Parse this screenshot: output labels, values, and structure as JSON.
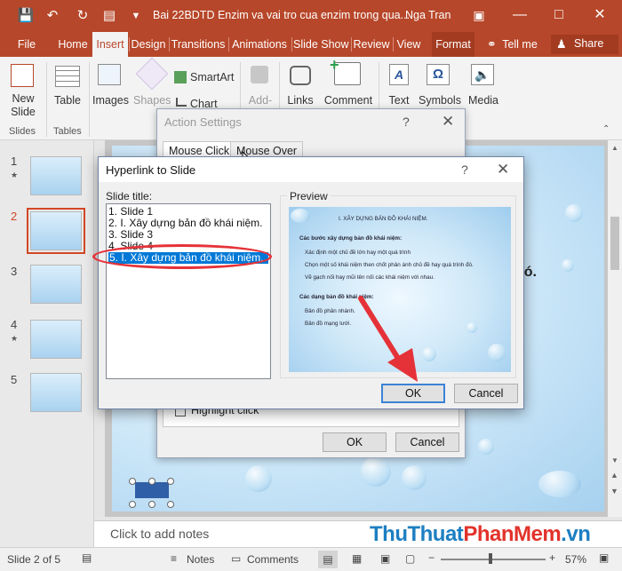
{
  "title_bar": {
    "document_title": "Bai 22BDTD Enzim va vai tro cua enzim trong qua...",
    "user_name": "Nga Tran"
  },
  "tabs": [
    {
      "label": "File"
    },
    {
      "label": "Home"
    },
    {
      "label": "Insert"
    },
    {
      "label": "Design"
    },
    {
      "label": "Transitions"
    },
    {
      "label": "Animations"
    },
    {
      "label": "Slide Show"
    },
    {
      "label": "Review"
    },
    {
      "label": "View"
    },
    {
      "label": "Format"
    },
    {
      "label": "Tell me"
    },
    {
      "label": "Share"
    }
  ],
  "ribbon": {
    "new_slide": "New\nSlide",
    "table": "Table",
    "images": "Images",
    "shapes": "Shapes",
    "smartart": "SmartArt",
    "chart": "Chart",
    "addins": "Add-",
    "links": "Links",
    "comment": "Comment",
    "text": "Text",
    "symbols": "Symbols",
    "media": "Media",
    "group_slides": "Slides",
    "group_tables": "Tables"
  },
  "thumbnails": [
    {
      "num": "1",
      "star": true
    },
    {
      "num": "2",
      "star": false
    },
    {
      "num": "3",
      "star": false
    },
    {
      "num": "4",
      "star": true
    },
    {
      "num": "5",
      "star": false
    }
  ],
  "slide": {
    "visible_text": "nh đó."
  },
  "action_settings": {
    "title": "Action Settings",
    "help": "?",
    "tab_mouse_click": "Mouse Click",
    "tab_mouse_over": "Mouse Over",
    "highlight_click": "Highlight click",
    "ok": "OK",
    "cancel": "Cancel"
  },
  "hyperlink_dialog": {
    "title": "Hyperlink to Slide",
    "help": "?",
    "slide_title_label": "Slide title:",
    "preview_label": "Preview",
    "slides": [
      "1. Slide 1",
      "2. I. Xây dựng bản đồ khái niệm.",
      "3. Slide 3",
      "4. Slide 4",
      "5. I. Xây dựng bản đồ khái niệm."
    ],
    "selected_index": 4,
    "ok": "OK",
    "cancel": "Cancel",
    "preview": {
      "title": "I. XÂY DỰNG BẢN ĐỒ KHÁI NIỆM.",
      "heading1": "Các bước xây dựng bản đồ khái niệm:",
      "b1": "Xác định một chủ đề lớn hay một quá trình",
      "b2": "Chọn một số khái niệm then chốt phản ánh chủ đề hay quá trình đó.",
      "b3": "Vẽ gạch nối hay mũi tên nối các khái niệm với nhau.",
      "heading2": "Các dạng bản đồ khái niệm:",
      "c1": "Bản đồ phân nhánh.",
      "c2": "Bản đồ mạng lưới."
    }
  },
  "notes": {
    "placeholder": "Click to add notes"
  },
  "status": {
    "slide_info": "Slide 2 of 5",
    "notes": "Notes",
    "comments": "Comments",
    "zoom": "57%"
  },
  "watermark": {
    "part1": "ThuThuat",
    "part2": "PhanMem",
    "part3": ".vn"
  },
  "colors": {
    "accent": "#b7472a",
    "selection": "#0078d7",
    "annotation": "#e53238"
  }
}
